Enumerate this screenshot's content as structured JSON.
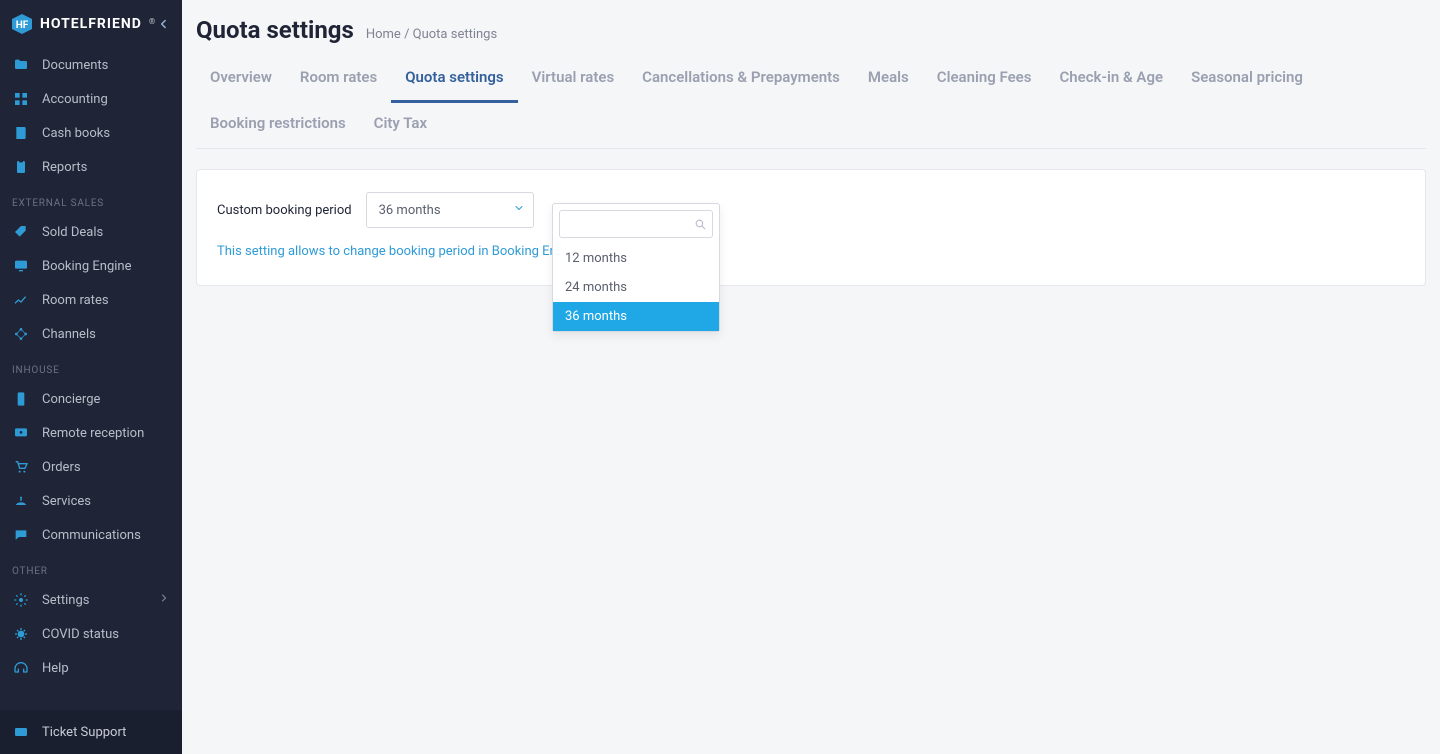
{
  "brand": {
    "name": "HOTELFRIEND"
  },
  "sidebar": {
    "groups": [
      {
        "header": null,
        "items": [
          {
            "label": "Documents",
            "icon": "folder-icon"
          },
          {
            "label": "Accounting",
            "icon": "grid-icon"
          },
          {
            "label": "Cash books",
            "icon": "book-icon"
          },
          {
            "label": "Reports",
            "icon": "clipboard-icon"
          }
        ]
      },
      {
        "header": "EXTERNAL SALES",
        "items": [
          {
            "label": "Sold Deals",
            "icon": "tag-icon"
          },
          {
            "label": "Booking Engine",
            "icon": "monitor-icon"
          },
          {
            "label": "Room rates",
            "icon": "chart-icon"
          },
          {
            "label": "Channels",
            "icon": "nodes-icon"
          }
        ]
      },
      {
        "header": "INHOUSE",
        "items": [
          {
            "label": "Concierge",
            "icon": "phone-icon"
          },
          {
            "label": "Remote reception",
            "icon": "reception-icon"
          },
          {
            "label": "Orders",
            "icon": "cart-icon"
          },
          {
            "label": "Services",
            "icon": "bell-icon"
          },
          {
            "label": "Communications",
            "icon": "chat-icon"
          }
        ]
      },
      {
        "header": "OTHER",
        "items": [
          {
            "label": "Settings",
            "icon": "gear-icon",
            "chevron": true
          },
          {
            "label": "COVID status",
            "icon": "virus-icon"
          },
          {
            "label": "Help",
            "icon": "headset-icon"
          }
        ]
      }
    ],
    "footer": {
      "label": "Ticket Support",
      "icon": "ticket-icon"
    }
  },
  "page": {
    "title": "Quota settings",
    "breadcrumb": {
      "home": "Home",
      "sep": "/",
      "current": "Quota settings"
    },
    "tabs": [
      "Overview",
      "Room rates",
      "Quota settings",
      "Virtual rates",
      "Cancellations & Prepayments",
      "Meals",
      "Cleaning Fees",
      "Check-in & Age",
      "Seasonal pricing",
      "Booking restrictions",
      "City Tax"
    ],
    "active_tab_index": 2,
    "field": {
      "label": "Custom booking period",
      "value": "36 months",
      "helper": "This setting allows to change booking period in Booking Engine and Channels"
    },
    "dropdown": {
      "search_placeholder": "",
      "options": [
        "12 months",
        "24 months",
        "36 months"
      ],
      "selected_index": 2
    }
  }
}
